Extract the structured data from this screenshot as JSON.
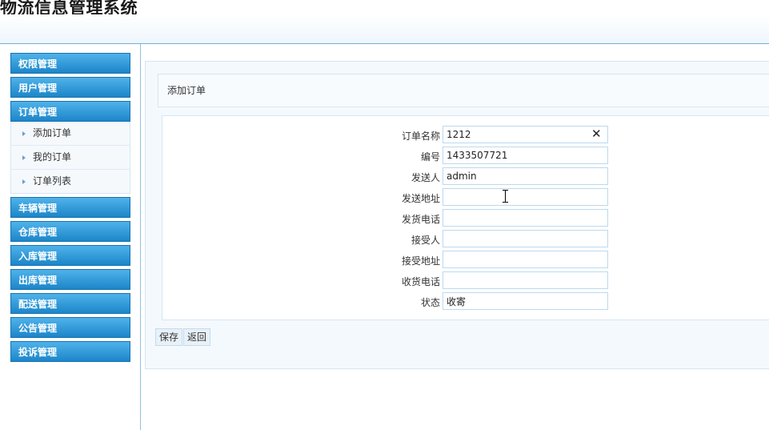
{
  "app": {
    "title": "物流信息管理系统"
  },
  "sidebar": {
    "groups": [
      {
        "label": "权限管理"
      },
      {
        "label": "用户管理"
      },
      {
        "label": "订单管理",
        "items": [
          "添加订单",
          "我的订单",
          "订单列表"
        ]
      },
      {
        "label": "车辆管理"
      },
      {
        "label": "仓库管理"
      },
      {
        "label": "入库管理"
      },
      {
        "label": "出库管理"
      },
      {
        "label": "配送管理"
      },
      {
        "label": "公告管理"
      },
      {
        "label": "投诉管理"
      }
    ]
  },
  "main": {
    "title": "添加订单",
    "form": {
      "fields": [
        {
          "label": "订单名称",
          "value": "1212"
        },
        {
          "label": "编号",
          "value": "1433507721"
        },
        {
          "label": "发送人",
          "value": "admin"
        },
        {
          "label": "发送地址",
          "value": ""
        },
        {
          "label": "发货电话",
          "value": ""
        },
        {
          "label": "接受人",
          "value": ""
        },
        {
          "label": "接受地址",
          "value": ""
        },
        {
          "label": "收货电话",
          "value": ""
        },
        {
          "label": "状态",
          "value": "收寄"
        }
      ]
    },
    "buttons": {
      "save": "保存",
      "back": "返回"
    }
  },
  "icons": {
    "clear": "close-icon",
    "submenu_arrow": "caret-right-icon"
  },
  "colors": {
    "menu_head": "#1c86c9",
    "border": "#8cc0e4"
  }
}
